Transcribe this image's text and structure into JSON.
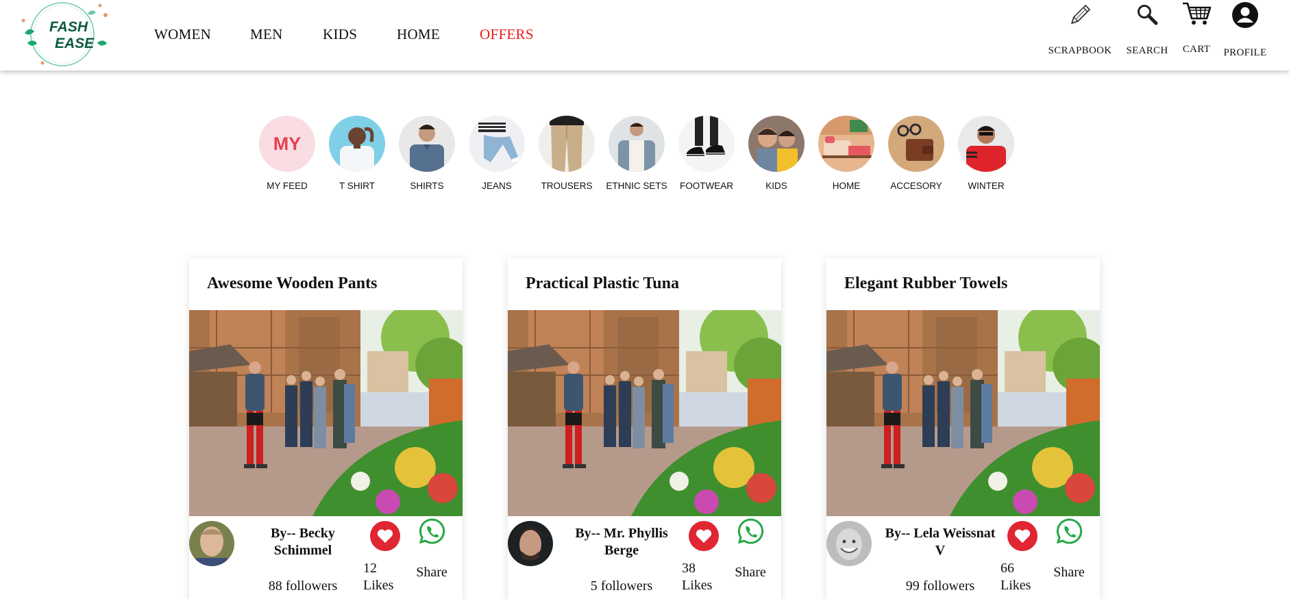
{
  "brand": {
    "line1": "FASH",
    "line2": "EASE",
    "color": "#0d5a3c"
  },
  "nav": {
    "women": "WOMEN",
    "men": "MEN",
    "kids": "KIDS",
    "home": "HOME",
    "offers": "OFFERS",
    "offers_color": "#f01a1a"
  },
  "header_actions": {
    "scrapbook": {
      "label": "SCRAPBOOK",
      "icon": "pencil-icon"
    },
    "search": {
      "label": "SEARCH",
      "icon": "magnifier-icon"
    },
    "cart": {
      "label": "CART",
      "icon": "cart-icon"
    },
    "profile": {
      "label": "PROFILE",
      "icon": "user-icon"
    }
  },
  "categories": [
    {
      "label": "MY FEED",
      "badge": "MY"
    },
    {
      "label": "T SHIRT"
    },
    {
      "label": "SHIRTS"
    },
    {
      "label": "JEANS"
    },
    {
      "label": "TROUSERS"
    },
    {
      "label": "ETHNIC SETS"
    },
    {
      "label": "FOOTWEAR"
    },
    {
      "label": "KIDS"
    },
    {
      "label": "HOME"
    },
    {
      "label": "ACCESORY"
    },
    {
      "label": "WINTER"
    }
  ],
  "posts": [
    {
      "title": "Awesome Wooden Pants",
      "author": "By-- Becky Schimmel",
      "followers": "88 followers",
      "likes_count": "12",
      "likes_word": "Likes",
      "share": "Share"
    },
    {
      "title": "Practical Plastic Tuna",
      "author": "By-- Mr. Phyllis Berge",
      "followers": "5 followers",
      "likes_count": "38",
      "likes_word": "Likes",
      "share": "Share"
    },
    {
      "title": "Elegant Rubber Towels",
      "author": "By-- Lela Weissnat V",
      "followers": "99 followers",
      "likes_count": "66",
      "likes_word": "Likes",
      "share": "Share"
    }
  ],
  "colors": {
    "like": "#e02633",
    "whatsapp": "#25a744",
    "myfeed_bg": "#f9dde3",
    "myfeed_text": "#e5414f"
  }
}
